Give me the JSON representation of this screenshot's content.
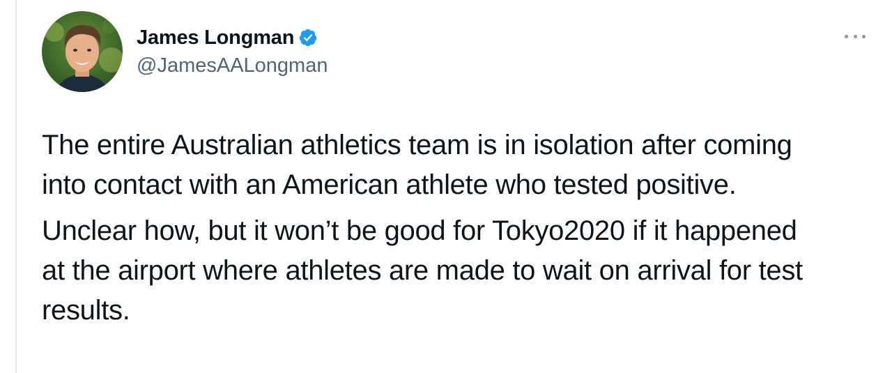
{
  "author": {
    "display_name": "James Longman",
    "handle": "@JamesAALongman",
    "verified": true
  },
  "tweet": {
    "paragraphs": [
      "The entire Australian athletics team is in isolation after coming\ninto contact with an American athlete who tested positive.",
      "Unclear how, but it won’t be good for Tokyo2020 if it happened\nat the airport where athletes are made to wait on arrival for test\nresults."
    ]
  },
  "icons": {
    "verified": "verified-badge-icon",
    "more": "more-options-icon"
  },
  "colors": {
    "text": "#0f1419",
    "secondary": "#536471",
    "verified": "#1d9bf0",
    "divider": "#e6e6e6"
  }
}
